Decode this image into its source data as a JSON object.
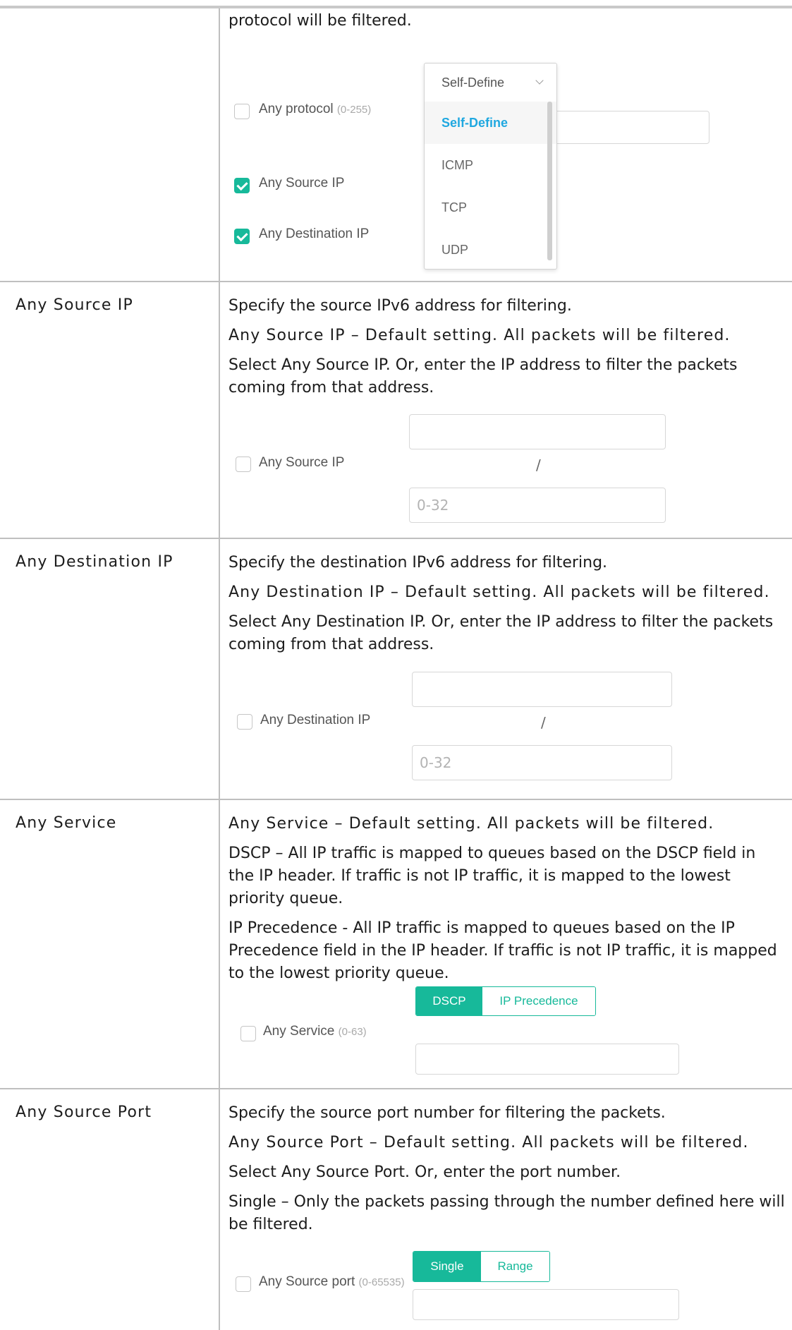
{
  "rows": {
    "protocol": {
      "desc": [
        "protocol will be filtered."
      ],
      "ui": {
        "any_protocol_label": "Any protocol",
        "any_protocol_hint": "(0-255)",
        "any_source_ip_label": "Any Source IP",
        "any_destination_ip_label": "Any Destination IP",
        "dropdown": {
          "selected": "Self-Define",
          "options": [
            "Self-Define",
            "ICMP",
            "TCP",
            "UDP"
          ]
        }
      }
    },
    "source_ip": {
      "term": "Any Source IP",
      "desc": [
        "Specify the source IPv6 address for filtering.",
        "Any Source IP – Default setting. All packets will be filtered.",
        "Select Any Source IP. Or, enter the IP address to filter the packets coming from that address."
      ],
      "ui": {
        "label": "Any Source IP",
        "slash": "/",
        "mask_placeholder": "0-32"
      }
    },
    "destination_ip": {
      "term": "Any Destination IP",
      "desc": [
        "Specify the destination IPv6 address for filtering.",
        "Any Destination IP – Default setting. All packets will be filtered.",
        "Select Any Destination IP. Or, enter the IP address to filter the packets coming from that address."
      ],
      "ui": {
        "label": "Any Destination IP",
        "slash": "/",
        "mask_placeholder": "0-32"
      }
    },
    "service": {
      "term": "Any Service",
      "desc": [
        "Any Service – Default setting. All packets will be filtered.",
        "DSCP – All IP traffic is mapped to queues based on the DSCP field in the IP header. If traffic is not IP traffic, it is mapped to the lowest priority queue.",
        "IP Precedence - All IP traffic is mapped to queues based on the IP Precedence field in the IP header. If traffic is not IP traffic, it is mapped to the lowest priority queue."
      ],
      "ui": {
        "label": "Any Service",
        "hint": "(0-63)",
        "seg_on": "DSCP",
        "seg_off": "IP Precedence"
      }
    },
    "source_port": {
      "term": "Any Source Port",
      "desc": [
        "Specify the source port number for filtering the packets.",
        "Any Source Port – Default setting. All packets will be filtered.",
        "Select Any Source Port. Or, enter the port number.",
        "Single – Only the packets passing through the number defined here will be filtered."
      ],
      "ui": {
        "label": "Any Source port",
        "hint": "(0-65535)",
        "seg_on": "Single",
        "seg_off": "Range"
      }
    }
  },
  "colors": {
    "accent": "#17b99a",
    "dropdown_active": "#20a8e0",
    "border": "#bfbfbf"
  }
}
